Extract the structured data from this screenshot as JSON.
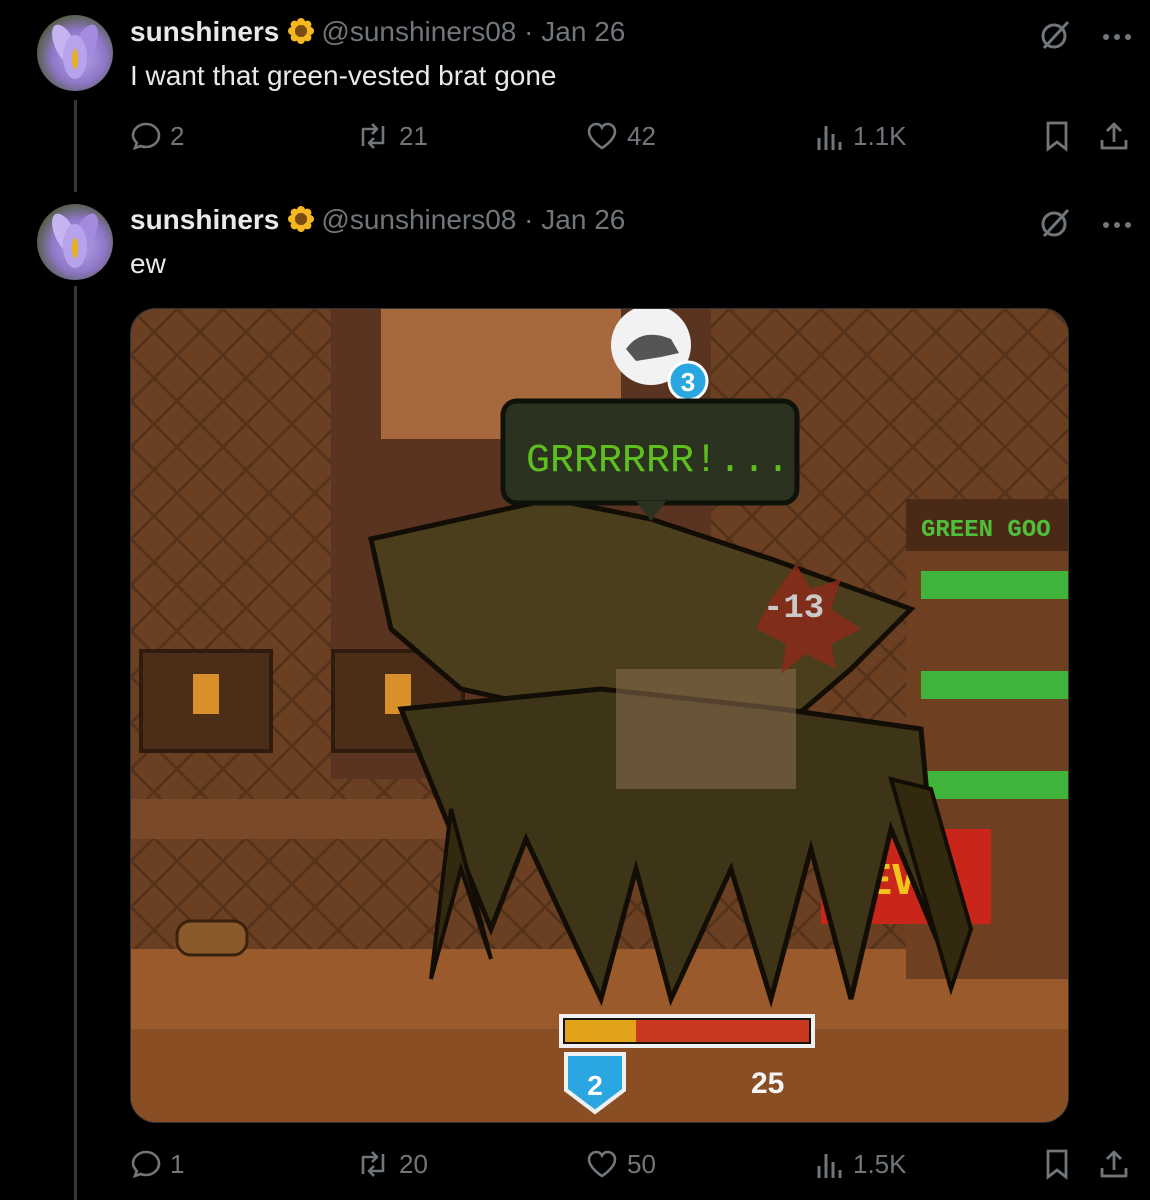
{
  "tweets": [
    {
      "display_name": "sunshiners",
      "handle": "@sunshiners08",
      "separator": "·",
      "date": "Jan 26",
      "text": "I want that green-vested brat gone",
      "replies": "2",
      "reposts": "21",
      "likes": "42",
      "views": "1.1K"
    },
    {
      "display_name": "sunshiners",
      "handle": "@sunshiners08",
      "separator": "·",
      "date": "Jan 26",
      "text": "ew",
      "replies": "1",
      "reposts": "20",
      "likes": "50",
      "views": "1.5K"
    }
  ],
  "game": {
    "speech_bubble": "GRRRRRR!...",
    "damage_number": "-13",
    "badge_count": "3",
    "store_sign": "GREEN GOO",
    "red_sign": "NEW!",
    "shield_level": "2",
    "hp_value": "25",
    "hp_fraction": 0.29
  },
  "icons": {
    "verified": "sunflower-icon",
    "grok": "grok-icon",
    "more": "more-icon",
    "reply": "reply-icon",
    "repost": "repost-icon",
    "like": "like-icon",
    "views": "views-icon",
    "bookmark": "bookmark-icon",
    "share": "share-icon"
  },
  "colors": {
    "background": "#000000",
    "text": "#e7e9ea",
    "muted": "#71767b",
    "bubble_text": "#5fbf1f",
    "hp_yellow": "#e0a31a",
    "hp_red": "#c8391f",
    "shield_blue": "#2aa7e0"
  }
}
